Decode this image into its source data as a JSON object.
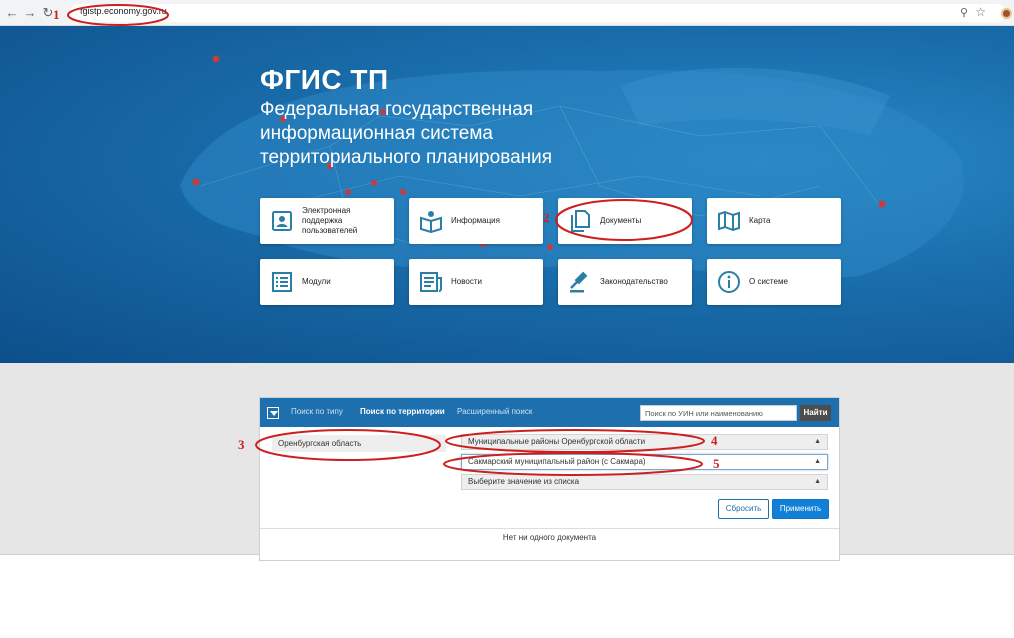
{
  "browser": {
    "url": "fgistp.economy.gov.ru",
    "icons": {
      "back": "back-arrow-icon",
      "forward": "forward-arrow-icon",
      "reload": "reload-icon",
      "zoom": "zoom-icon",
      "bookmark": "star-icon",
      "profile": "profile-icon"
    }
  },
  "hero": {
    "title": "ФГИС ТП",
    "subtitle_lines": [
      "Федеральная государственная",
      "информационная система",
      "территориального планирования"
    ]
  },
  "tiles": [
    {
      "label": "Электронная поддержка пользователей",
      "icon": "user-support-icon"
    },
    {
      "label": "Информация",
      "icon": "information-icon"
    },
    {
      "label": "Документы",
      "icon": "documents-icon"
    },
    {
      "label": "Карта",
      "icon": "map-icon"
    },
    {
      "label": "Модули",
      "icon": "modules-icon"
    },
    {
      "label": "Новости",
      "icon": "news-icon"
    },
    {
      "label": "Законодательство",
      "icon": "gavel-icon"
    },
    {
      "label": "О системе",
      "icon": "info-circle-icon"
    }
  ],
  "search": {
    "tabs": [
      "Поиск по типу",
      "Поиск по территории",
      "Расширенный поиск"
    ],
    "active_tab": "Поиск по территории",
    "input_placeholder": "Поиск по УИН или наименованию",
    "find_label": "Найти",
    "region": "Оренбургская область",
    "selects": [
      "Муниципальные районы Оренбургской области",
      "Сакмарский муниципальный район (с Сакмара)",
      "Выберите значение из списка"
    ],
    "reset_label": "Сбросить",
    "apply_label": "Применить",
    "empty_message": "Нет ни одного документа"
  },
  "annotations": {
    "numbers": [
      "1",
      "2",
      "3",
      "4",
      "5"
    ],
    "color": "#cc1f1f"
  },
  "colors": {
    "brand_blue": "#1d6fad",
    "icon_teal": "#2b7fa6",
    "apply_blue": "#1380d8",
    "find_dark": "#4d4d4d"
  }
}
